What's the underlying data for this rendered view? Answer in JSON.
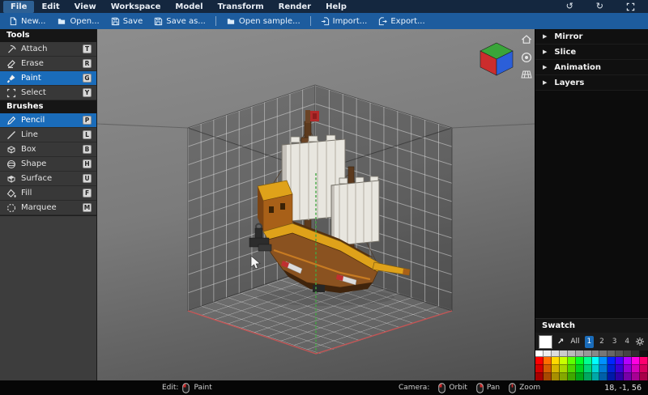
{
  "menu": {
    "items": [
      "File",
      "Edit",
      "View",
      "Workspace",
      "Model",
      "Transform",
      "Render",
      "Help"
    ],
    "active": "File"
  },
  "window_icons": {
    "undo": "↺",
    "redo": "↻"
  },
  "toolbar": {
    "buttons": [
      "New...",
      "Open...",
      "Save",
      "Save as...",
      "Open sample...",
      "Import...",
      "Export..."
    ]
  },
  "tools": {
    "header": "Tools",
    "items": [
      {
        "label": "Attach",
        "shortcut": "T",
        "selected": false
      },
      {
        "label": "Erase",
        "shortcut": "R",
        "selected": false
      },
      {
        "label": "Paint",
        "shortcut": "G",
        "selected": true
      },
      {
        "label": "Select",
        "shortcut": "Y",
        "selected": false
      }
    ]
  },
  "brushes": {
    "header": "Brushes",
    "items": [
      {
        "label": "Pencil",
        "shortcut": "P",
        "selected": true
      },
      {
        "label": "Line",
        "shortcut": "L",
        "selected": false
      },
      {
        "label": "Box",
        "shortcut": "B",
        "selected": false
      },
      {
        "label": "Shape",
        "shortcut": "H",
        "selected": false
      },
      {
        "label": "Surface",
        "shortcut": "U",
        "selected": false
      },
      {
        "label": "Fill",
        "shortcut": "F",
        "selected": false
      },
      {
        "label": "Marquee",
        "shortcut": "M",
        "selected": false
      }
    ]
  },
  "right_panels": {
    "items": [
      "Mirror",
      "Slice",
      "Animation",
      "Layers"
    ],
    "arrow": "▶"
  },
  "swatch": {
    "title": "Swatch",
    "current_color": "#ffffff",
    "pick_icon": "↗",
    "all_label": "All",
    "tabs": [
      "1",
      "2",
      "3",
      "4"
    ],
    "active_tab": "1",
    "grid": [
      [
        "#ffffff",
        "#eeeeee",
        "#dddddd",
        "#cccccc",
        "#bbbbbb",
        "#aaaaaa",
        "#999999",
        "#888888",
        "#777777",
        "#666666",
        "#555555",
        "#444444",
        "#2e2e2e",
        "#111111"
      ],
      [
        "#ff0000",
        "#ff6e00",
        "#ffd900",
        "#c8ff00",
        "#5eff00",
        "#00ff26",
        "#00ff91",
        "#00ffff",
        "#0091ff",
        "#0026ff",
        "#4800ff",
        "#b300ff",
        "#ff00e1",
        "#ff006e"
      ],
      [
        "#d60000",
        "#d65c00",
        "#d6b600",
        "#a8d600",
        "#4fd600",
        "#00d620",
        "#00d67a",
        "#00d6d6",
        "#007ad6",
        "#0020d6",
        "#3c00d6",
        "#9600d6",
        "#d600bd",
        "#d6005c"
      ],
      [
        "#a80000",
        "#a84800",
        "#a88f00",
        "#84a800",
        "#3ea800",
        "#00a819",
        "#00a85f",
        "#00a8a8",
        "#005fa8",
        "#0019a8",
        "#2f00a8",
        "#7600a8",
        "#a80094",
        "#a80048"
      ]
    ]
  },
  "status": {
    "edit_label": "Edit:",
    "edit_mode": "Paint",
    "camera_label": "Camera:",
    "camera_modes": [
      "Orbit",
      "Pan",
      "Zoom"
    ],
    "coordinates": "18, -1, 56"
  },
  "colors": {
    "accent": "#1a6cba",
    "menubar_bg": "#14273f",
    "toolbar_bg": "#1d5c9e",
    "viewport_top": "#8d8d8d",
    "viewport_bottom": "#4e4e4e",
    "axis_green": "#43a843",
    "axis_red": "#c25555",
    "flag_red": "#b22a2a",
    "hull_gold": "#dfa21a",
    "hull_brown": "#8a5220",
    "sail": "#e8e6df"
  }
}
